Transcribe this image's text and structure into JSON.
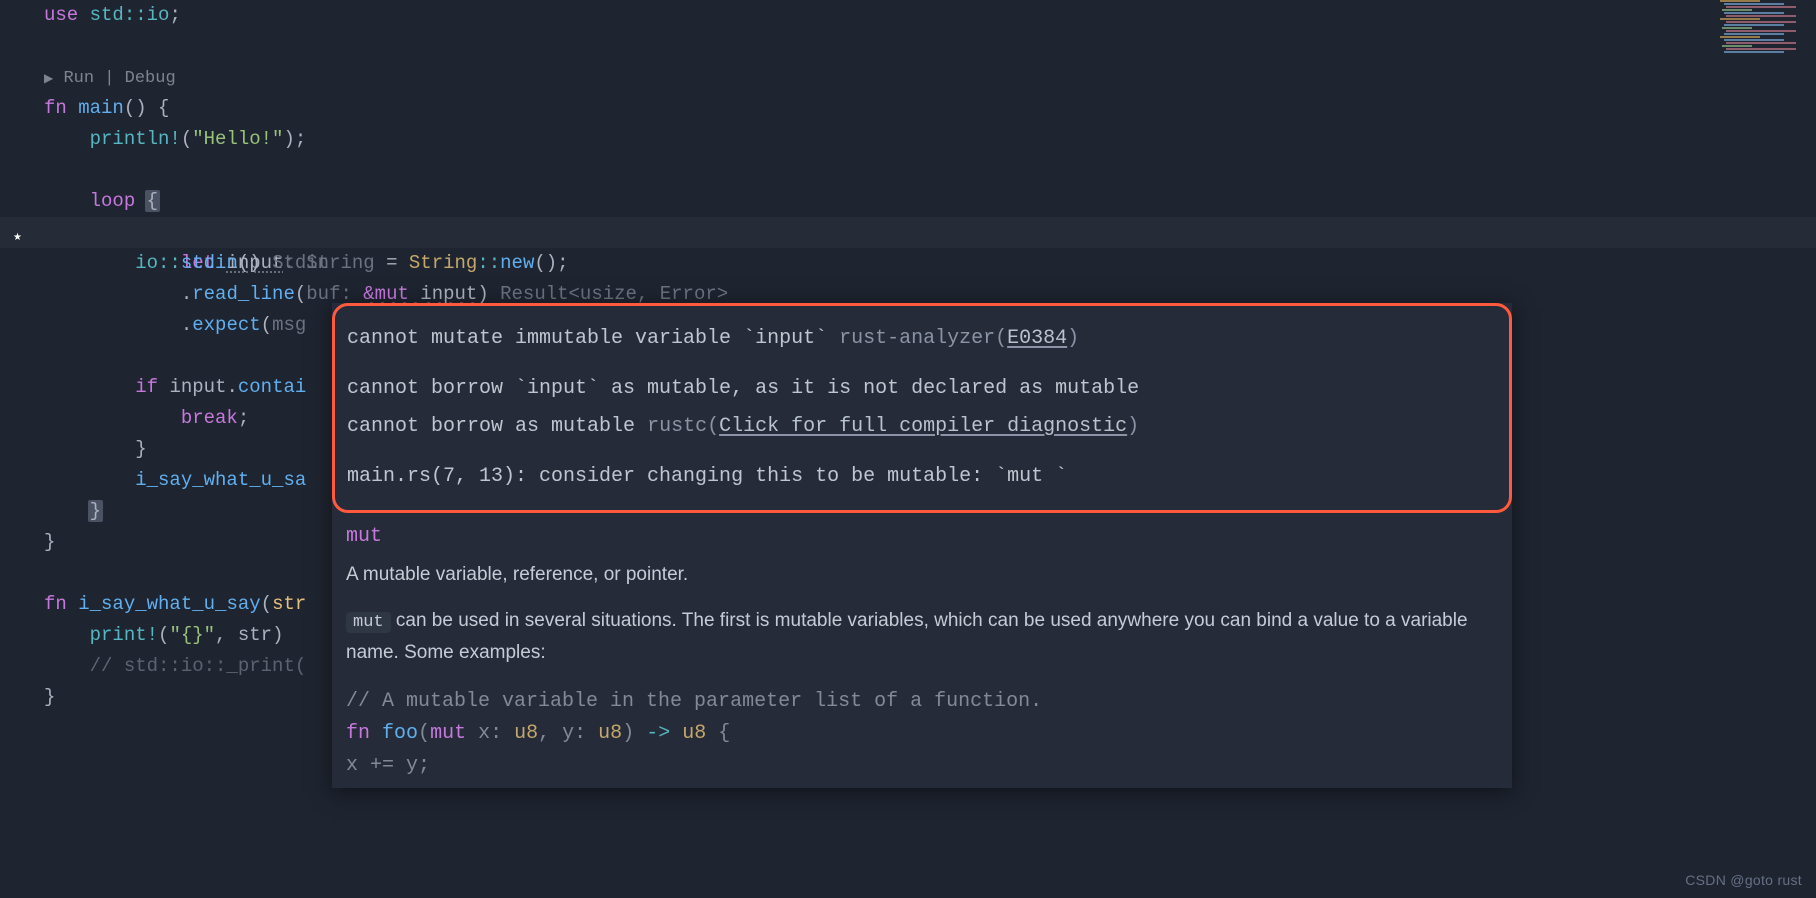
{
  "code": {
    "l1_use": "use",
    "l1_path1": "std",
    "l1_path2": "io",
    "codelens_run": "Run",
    "codelens_debug": "Debug",
    "l3_fn": "fn",
    "l3_name": "main",
    "l4_macro": "println!",
    "l4_str": "\"Hello!\"",
    "l6_loop": "loop",
    "l7_let": "let",
    "l7_var": "input",
    "l7_ty_hint": ": String",
    "l7_eq": " = ",
    "l7_ty": "String",
    "l7_new": "new",
    "l8_io": "io",
    "l8_stdin": "stdin",
    "l8_hint": " Stdin",
    "l9_method": "read_line",
    "l9_buf_label": "buf: ",
    "l9_mut": "&mut ",
    "l9_arg": "input",
    "l9_hint": " Result<usize, Error>",
    "l10_method": "expect",
    "l10_label": "msg",
    "l12_if": "if",
    "l12_var": "input",
    "l12_contai": "contai",
    "l13_break": "break",
    "l15_call": "i_say_what_u_sa",
    "l19_fn": "fn",
    "l19_name": "i_say_what_u_say",
    "l19_param": "str",
    "l20_macro": "print!",
    "l20_fmt": "\"{}\"",
    "l20_arg": "str",
    "l21_comment": "// std::io::_print("
  },
  "hover": {
    "err1_pre": "cannot mutate immutable variable `input` ",
    "err1_src": "rust-analyzer(",
    "err1_code": "E0384",
    "err1_close": ")",
    "err2": "cannot borrow `input` as mutable, as it is not declared as mutable",
    "err3_pre": "cannot borrow as mutable ",
    "err3_src": "rustc(",
    "err3_link": "Click for full compiler diagnostic",
    "err3_close": ")",
    "err4": "main.rs(7, 13): consider changing this to be mutable: `mut `",
    "mut_kw": "mut",
    "desc": "A mutable variable, reference, or pointer.",
    "para_pre": "",
    "para": " can be used in several situations. The first is mutable variables, which can be used anywhere you can bind a value to a variable name. Some examples:",
    "ex_comment": "// A mutable variable in the parameter list of a function.",
    "ex_l1_fn": "fn",
    "ex_l1_foo": "foo",
    "ex_l1_mut": "mut",
    "ex_l1_x": " x",
    "ex_l1_u8": "u8",
    "ex_l1_y": " y",
    "ex_l1_arrow": " -> ",
    "ex_l2": "x += y;"
  },
  "watermark": "CSDN @goto rust"
}
